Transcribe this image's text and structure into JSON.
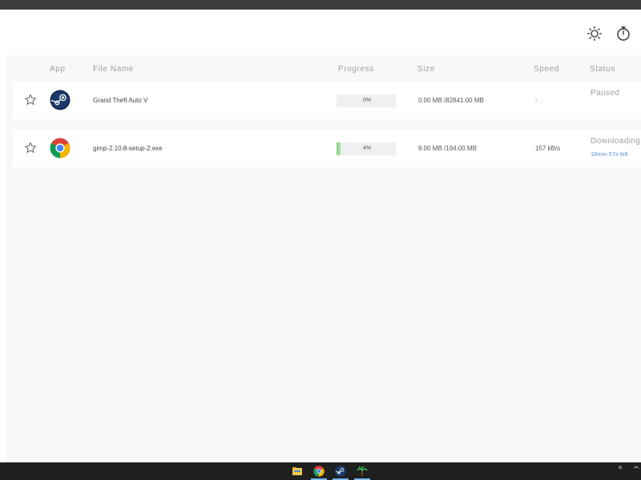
{
  "header": {
    "theme_icon": "sun-icon",
    "timer_icon": "stopwatch-icon"
  },
  "table": {
    "columns": {
      "app": "App",
      "file_name": "File Name",
      "progress": "Progress",
      "size": "Size",
      "speed": "Speed",
      "status": "Status"
    },
    "rows": [
      {
        "app_icon": "steam-icon",
        "file_name": "Grand Theft Auto V",
        "progress_label": "0%",
        "progress_value": 0,
        "size": "0.00 MB /82841.00 MB",
        "speed": "-",
        "status": "Paused",
        "status_sub": ""
      },
      {
        "app_icon": "chrome-icon",
        "file_name": "gimp-2.10.8-setup-2.exe",
        "progress_label": "4%",
        "progress_value": 4,
        "size": "9.00 MB /194.00 MB",
        "speed": "157 kB/s",
        "status": "Downloading",
        "status_sub": "18min 57s left"
      }
    ]
  },
  "taskbar": {
    "items": [
      "file-explorer-icon",
      "chrome-icon",
      "steam-icon",
      "palm-tree-icon"
    ],
    "tray": [
      "people-icon",
      "chevron-up-icon"
    ]
  },
  "colors": {
    "progress_fill": "#a8dca0",
    "status_link": "#5b8fd6",
    "accent_taskbar": "#76b9ed"
  }
}
